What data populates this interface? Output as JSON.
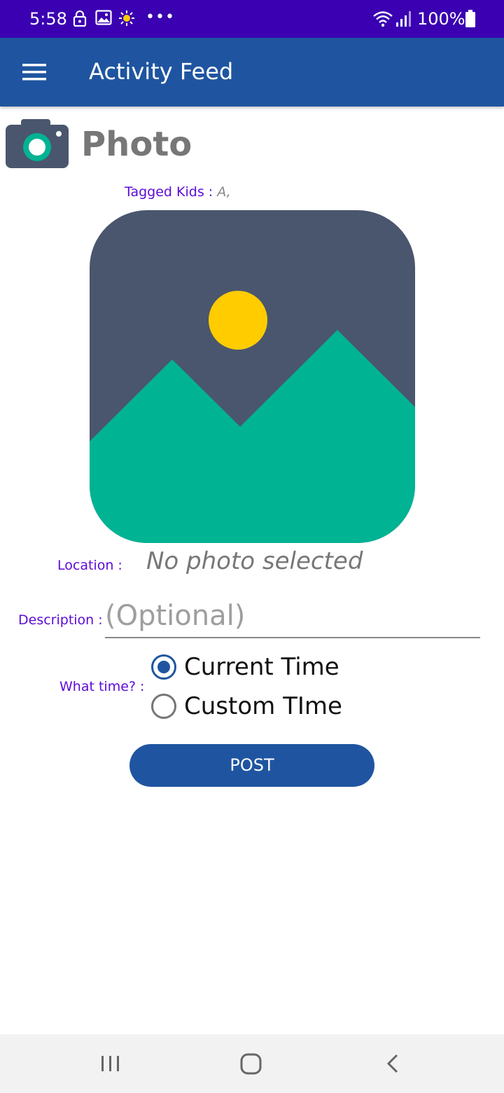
{
  "status_bar": {
    "time": "5:58",
    "battery": "100%",
    "overflow": "•••",
    "icons": [
      "lock-icon",
      "image-icon",
      "brightness-icon",
      "wifi-icon",
      "signal-icon",
      "battery-icon"
    ]
  },
  "app_bar": {
    "title": "Activity Feed",
    "menu_icon": "hamburger-menu-icon"
  },
  "header": {
    "icon": "camera-icon",
    "title": "Photo"
  },
  "tagged": {
    "label": "Tagged Kids : ",
    "value": "A,"
  },
  "photo": {
    "placeholder_icon": "image-placeholder-icon"
  },
  "location": {
    "label": "Location :",
    "value": "No photo selected"
  },
  "description": {
    "label": "Description :",
    "placeholder": "(Optional)",
    "value": ""
  },
  "time_choice": {
    "label": "What time? :",
    "options": [
      {
        "label": "Current Time",
        "selected": true
      },
      {
        "label": "Custom TIme",
        "selected": false
      }
    ]
  },
  "post_button": {
    "label": "POST"
  },
  "nav_bar": {
    "buttons": [
      "recent-apps-icon",
      "home-icon",
      "back-icon"
    ]
  },
  "colors": {
    "status_bar": "#3a00b2",
    "app_bar": "#1f55a0",
    "accent_purple": "#5d0ad6",
    "placeholder_bg": "#4a566d",
    "placeholder_sun": "#ffcc00",
    "placeholder_hills": "#00b393"
  }
}
